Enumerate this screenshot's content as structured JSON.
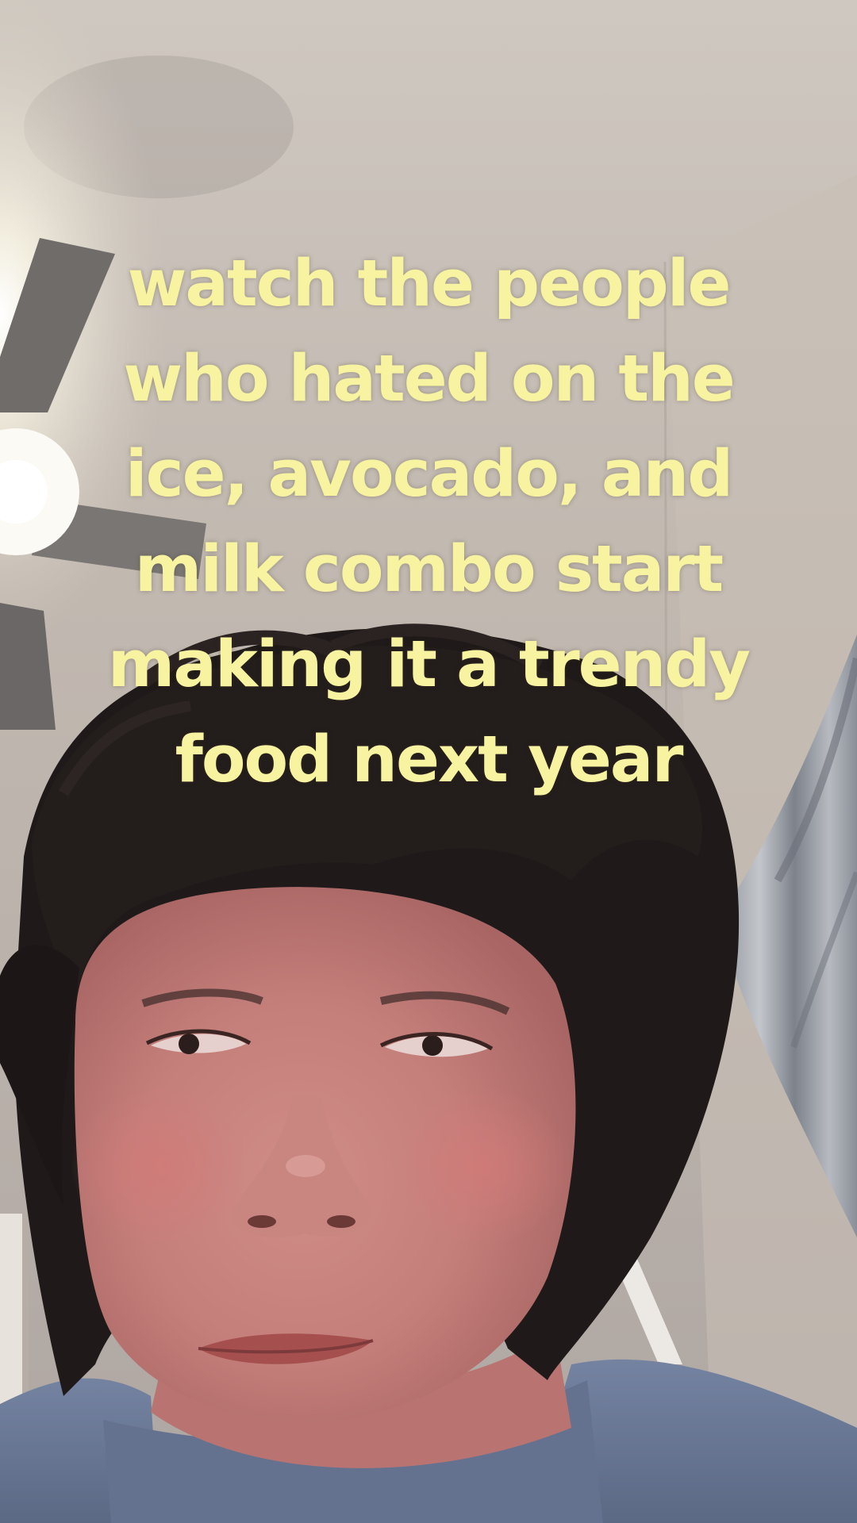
{
  "caption": {
    "lines": [
      "watch the people",
      "who hated on the",
      "ice, avocado, and",
      "milk combo start",
      "making it a trendy",
      "food next year"
    ],
    "color": "#f7f3a0"
  },
  "scene": {
    "subject": "person with dark shaggy hair looking up at camera",
    "objects": [
      "ceiling-fan-icon",
      "ceiling-light",
      "curtain",
      "doorframe"
    ]
  }
}
